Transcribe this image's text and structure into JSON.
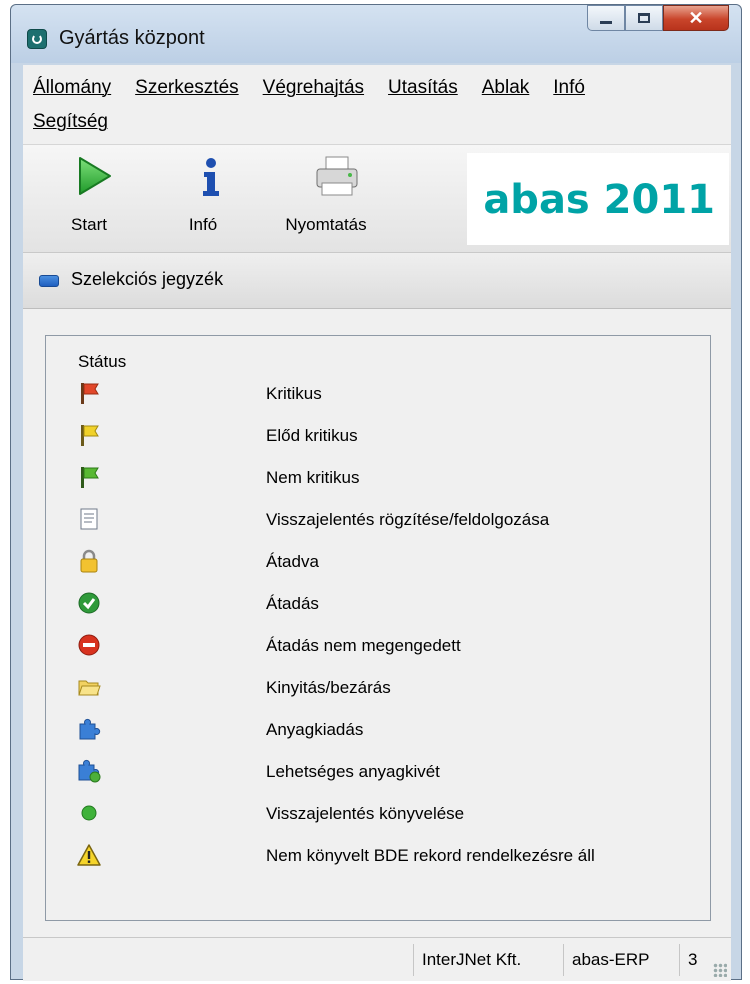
{
  "window": {
    "title": "Gyártás központ",
    "icon": "app-icon",
    "buttons": {
      "minimize": "minimize-icon",
      "maximize": "maximize-icon",
      "close": "close-icon"
    }
  },
  "menu": {
    "items": [
      "Állomány",
      "Szerkesztés",
      "Végrehajtás",
      "Utasítás",
      "Ablak",
      "Infó",
      "Segítség"
    ]
  },
  "toolbar": {
    "start_label": "Start",
    "info_label": "Infó",
    "print_label": "Nyomtatás",
    "brand": "abas 2011",
    "brand_color": "#00a3a6"
  },
  "selection": {
    "label": "Szelekciós jegyzék"
  },
  "status_list": {
    "header": "Státus",
    "items": [
      {
        "icon": "red-flag-icon",
        "label": "Kritikus"
      },
      {
        "icon": "yellow-flag-icon",
        "label": "Előd kritikus"
      },
      {
        "icon": "green-flag-icon",
        "label": "Nem kritikus"
      },
      {
        "icon": "document-icon",
        "label": "Visszajelentés rögzítése/feldolgozása"
      },
      {
        "icon": "lock-icon",
        "label": "Átadva"
      },
      {
        "icon": "check-icon",
        "label": "Átadás"
      },
      {
        "icon": "no-entry-icon",
        "label": "Átadás nem megengedett"
      },
      {
        "icon": "folder-icon",
        "label": "Kinyitás/bezárás"
      },
      {
        "icon": "puzzle-icon",
        "label": "Anyagkiadás"
      },
      {
        "icon": "puzzle-green-icon",
        "label": "Lehetséges anyagkivét"
      },
      {
        "icon": "green-dot-icon",
        "label": "Visszajelentés könyvelése"
      },
      {
        "icon": "warning-icon",
        "label": "Nem könyvelt BDE rekord rendelkezésre áll"
      }
    ]
  },
  "statusbar": {
    "company": "InterJNet Kft.",
    "product": "abas-ERP",
    "count": "3"
  }
}
